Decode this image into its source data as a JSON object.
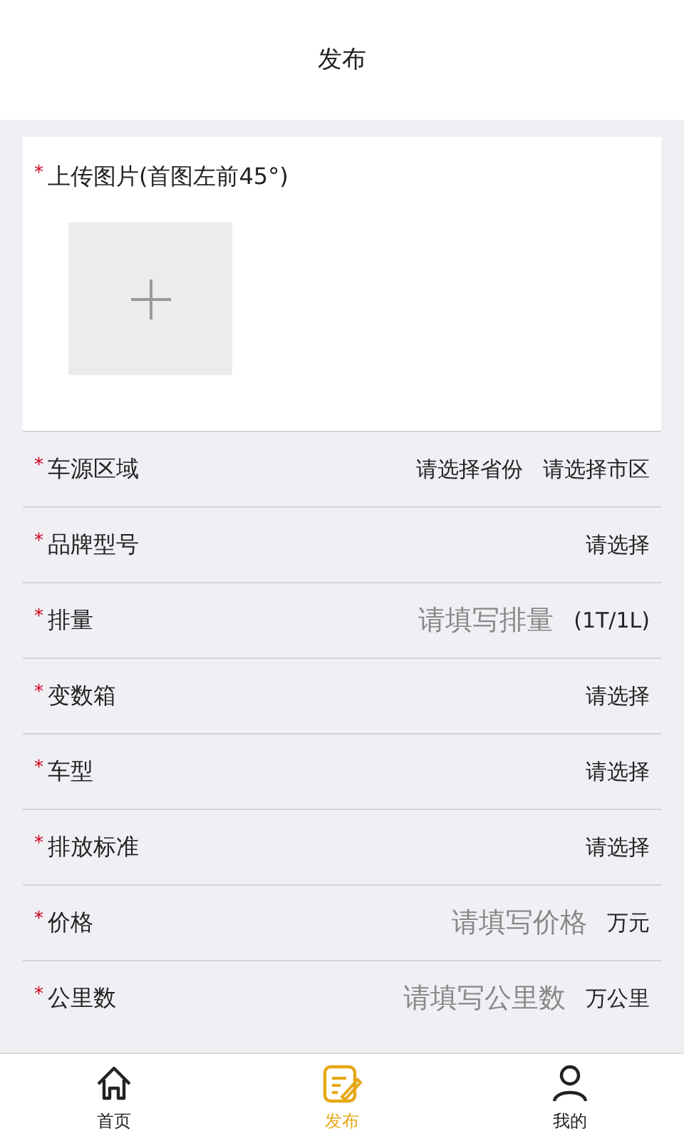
{
  "header": {
    "title": "发布"
  },
  "upload": {
    "label": "上传图片(首图左前45°)",
    "mark": "*"
  },
  "fields": [
    {
      "label": "车源区域",
      "mark": "*",
      "kind": "select",
      "options": [
        "请选择省份",
        "请选择市区"
      ]
    },
    {
      "label": "品牌型号",
      "mark": "*",
      "kind": "select",
      "options": [
        "请选择"
      ]
    },
    {
      "label": "排量",
      "mark": "*",
      "kind": "input",
      "placeholder": "请填写排量",
      "unit": "(1T/1L)"
    },
    {
      "label": "变数箱",
      "mark": "*",
      "kind": "select",
      "options": [
        "请选择"
      ]
    },
    {
      "label": "车型",
      "mark": "*",
      "kind": "select",
      "options": [
        "请选择"
      ]
    },
    {
      "label": "排放标准",
      "mark": "*",
      "kind": "select",
      "options": [
        "请选择"
      ]
    },
    {
      "label": "价格",
      "mark": "*",
      "kind": "input",
      "placeholder": "请填写价格",
      "unit": "万元"
    },
    {
      "label": "公里数",
      "mark": "*",
      "kind": "input",
      "placeholder": "请填写公里数",
      "unit": "万公里"
    }
  ],
  "tabs": [
    {
      "label": "首页",
      "kind": "home",
      "selected": false
    },
    {
      "label": "发布",
      "kind": "publish",
      "selected": true
    },
    {
      "label": "我的",
      "kind": "me",
      "selected": false
    }
  ]
}
